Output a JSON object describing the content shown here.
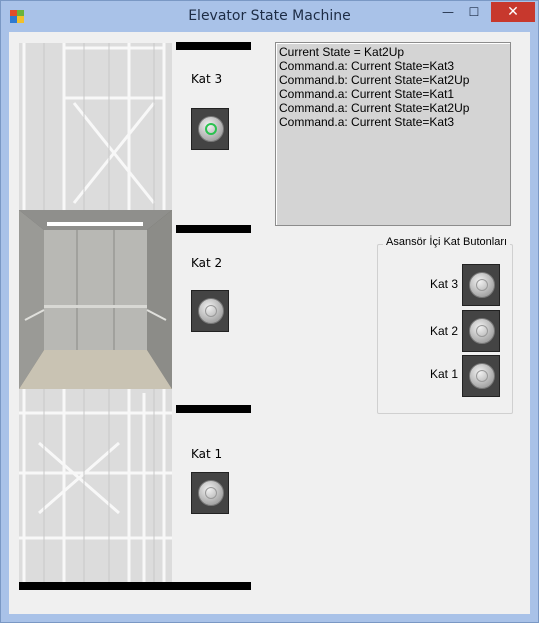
{
  "window": {
    "title": "Elevator State Machine",
    "minimize": "—",
    "maximize": "☐",
    "close": "✕"
  },
  "floors": [
    {
      "label": "Kat 3",
      "active": true
    },
    {
      "label": "Kat 2",
      "active": false
    },
    {
      "label": "Kat 1",
      "active": false
    }
  ],
  "log": {
    "lines": [
      "Current State = Kat2Up",
      "Command.a: Current State=Kat3",
      "Command.b: Current State=Kat2Up",
      "Command.a: Current State=Kat1",
      "Command.a: Current State=Kat2Up",
      "Command.a: Current State=Kat3"
    ]
  },
  "inner_panel": {
    "title": "Asansör İçi Kat Butonları",
    "buttons": [
      "Kat 3",
      "Kat 2",
      "Kat 1"
    ]
  },
  "colors": {
    "titlebar": "#a9c2e8",
    "close": "#c7382d",
    "active_glow": "#2ac24f"
  }
}
